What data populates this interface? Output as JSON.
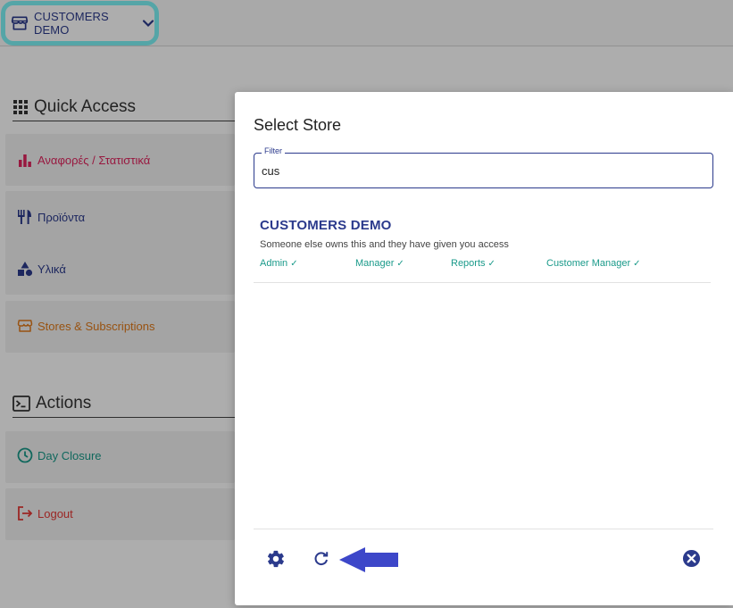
{
  "colors": {
    "accent": "#2b3a8c",
    "highlight": "#7ef3f6",
    "reports": "#e0245e",
    "stores": "#e07a1a",
    "closure": "#1a9a8a",
    "logout": "#e53935",
    "arrow": "#3d47c9"
  },
  "header": {
    "store_selector": {
      "icon": "store-icon",
      "label": "CUSTOMERS DEMO",
      "chevron": "chevron-down-icon"
    }
  },
  "quick_access": {
    "title": "Quick Access",
    "icon": "apps-grid-icon",
    "items": [
      {
        "label": "Αναφορές / Στατιστικά",
        "icon": "bar-chart-icon"
      },
      {
        "label": "Προϊόντα",
        "icon": "restaurant-icon"
      },
      {
        "label": "Υλικά",
        "icon": "shapes-icon"
      },
      {
        "label": "Stores & Subscriptions",
        "icon": "store-icon"
      }
    ]
  },
  "actions": {
    "title": "Actions",
    "icon": "terminal-icon",
    "items": [
      {
        "label": "Day Closure",
        "icon": "clock-icon"
      },
      {
        "label": "Logout",
        "icon": "logout-icon"
      }
    ]
  },
  "dialog": {
    "title": "Select Store",
    "filter": {
      "label": "Filter",
      "value": "cus"
    },
    "results": [
      {
        "name": "CUSTOMERS DEMO",
        "description": "Someone else owns this and they have given you access",
        "roles": [
          "Admin",
          "Manager",
          "Reports",
          "Customer Manager"
        ]
      }
    ],
    "footer": {
      "settings_icon": "gear-icon",
      "refresh_icon": "refresh-icon",
      "close_icon": "close-circle-icon",
      "annotation_icon": "arrow-left-icon"
    }
  }
}
